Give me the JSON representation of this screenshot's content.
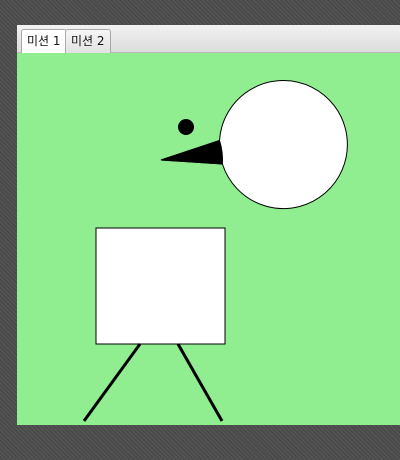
{
  "tabs": [
    {
      "label": "미션 1",
      "active": true
    },
    {
      "label": "미션 2",
      "active": false
    }
  ],
  "colors": {
    "stage_background": "#90ee90",
    "figure_fill": "#ffffff",
    "outline": "#000000",
    "desktop_background": "#4a4a4a"
  }
}
